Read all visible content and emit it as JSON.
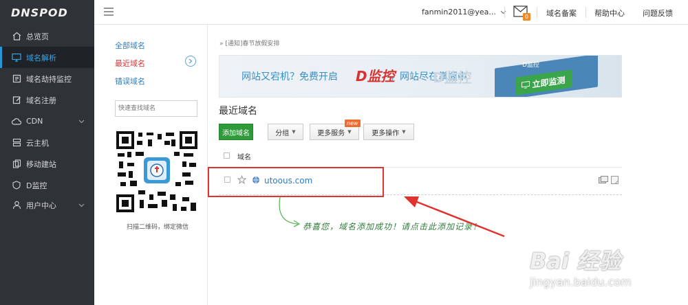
{
  "brand": "DNSPOD",
  "sidebar": {
    "items": [
      {
        "label": "总览页",
        "icon": "home-icon"
      },
      {
        "label": "域名解析",
        "icon": "monitor-icon"
      },
      {
        "label": "域名劫持监控",
        "icon": "shield-list-icon"
      },
      {
        "label": "域名注册",
        "icon": "edit-icon"
      },
      {
        "label": "CDN",
        "icon": "cloud-icon"
      },
      {
        "label": "云主机",
        "icon": "server-icon"
      },
      {
        "label": "移动建站",
        "icon": "mobile-icon"
      },
      {
        "label": "D监控",
        "icon": "shield-icon"
      },
      {
        "label": "用户中心",
        "icon": "user-icon"
      }
    ]
  },
  "header": {
    "user": "fanmin2011@yea...",
    "mail_count": "0",
    "links": [
      "域名备案",
      "帮助中心",
      "问题反馈"
    ]
  },
  "subnav": {
    "links": [
      "全部域名",
      "最近域名",
      "错误域名"
    ],
    "search_placeholder": "快速查找域名",
    "qr_caption": "扫描二维码，绑定微信"
  },
  "main": {
    "notice": "» [通知]春节放假安排",
    "banner": {
      "text1": "网站又宕机？免费开启",
      "logo": "D监控",
      "text2": "，网站尽在掌握中",
      "watermark": "D监控",
      "card_label": "D监控",
      "button": "立即监测"
    },
    "section_title": "最近域名",
    "buttons": {
      "add": "添加域名",
      "group": "分组",
      "more_services": "更多服务",
      "more_actions": "更多操作",
      "new_badge": "new"
    },
    "table": {
      "header": "域名",
      "rows": [
        {
          "domain": "utoous.com"
        }
      ]
    },
    "hint": "恭喜您，域名添加成功！请点击此添加记录！"
  },
  "watermark": {
    "main": "Bai 经验",
    "url": "jingyan.baidu.com"
  },
  "colors": {
    "sidebar_bg": "#2f3236",
    "accent": "#2696d8",
    "primary_button": "#2f9a3a",
    "highlight": "#e0332f"
  }
}
